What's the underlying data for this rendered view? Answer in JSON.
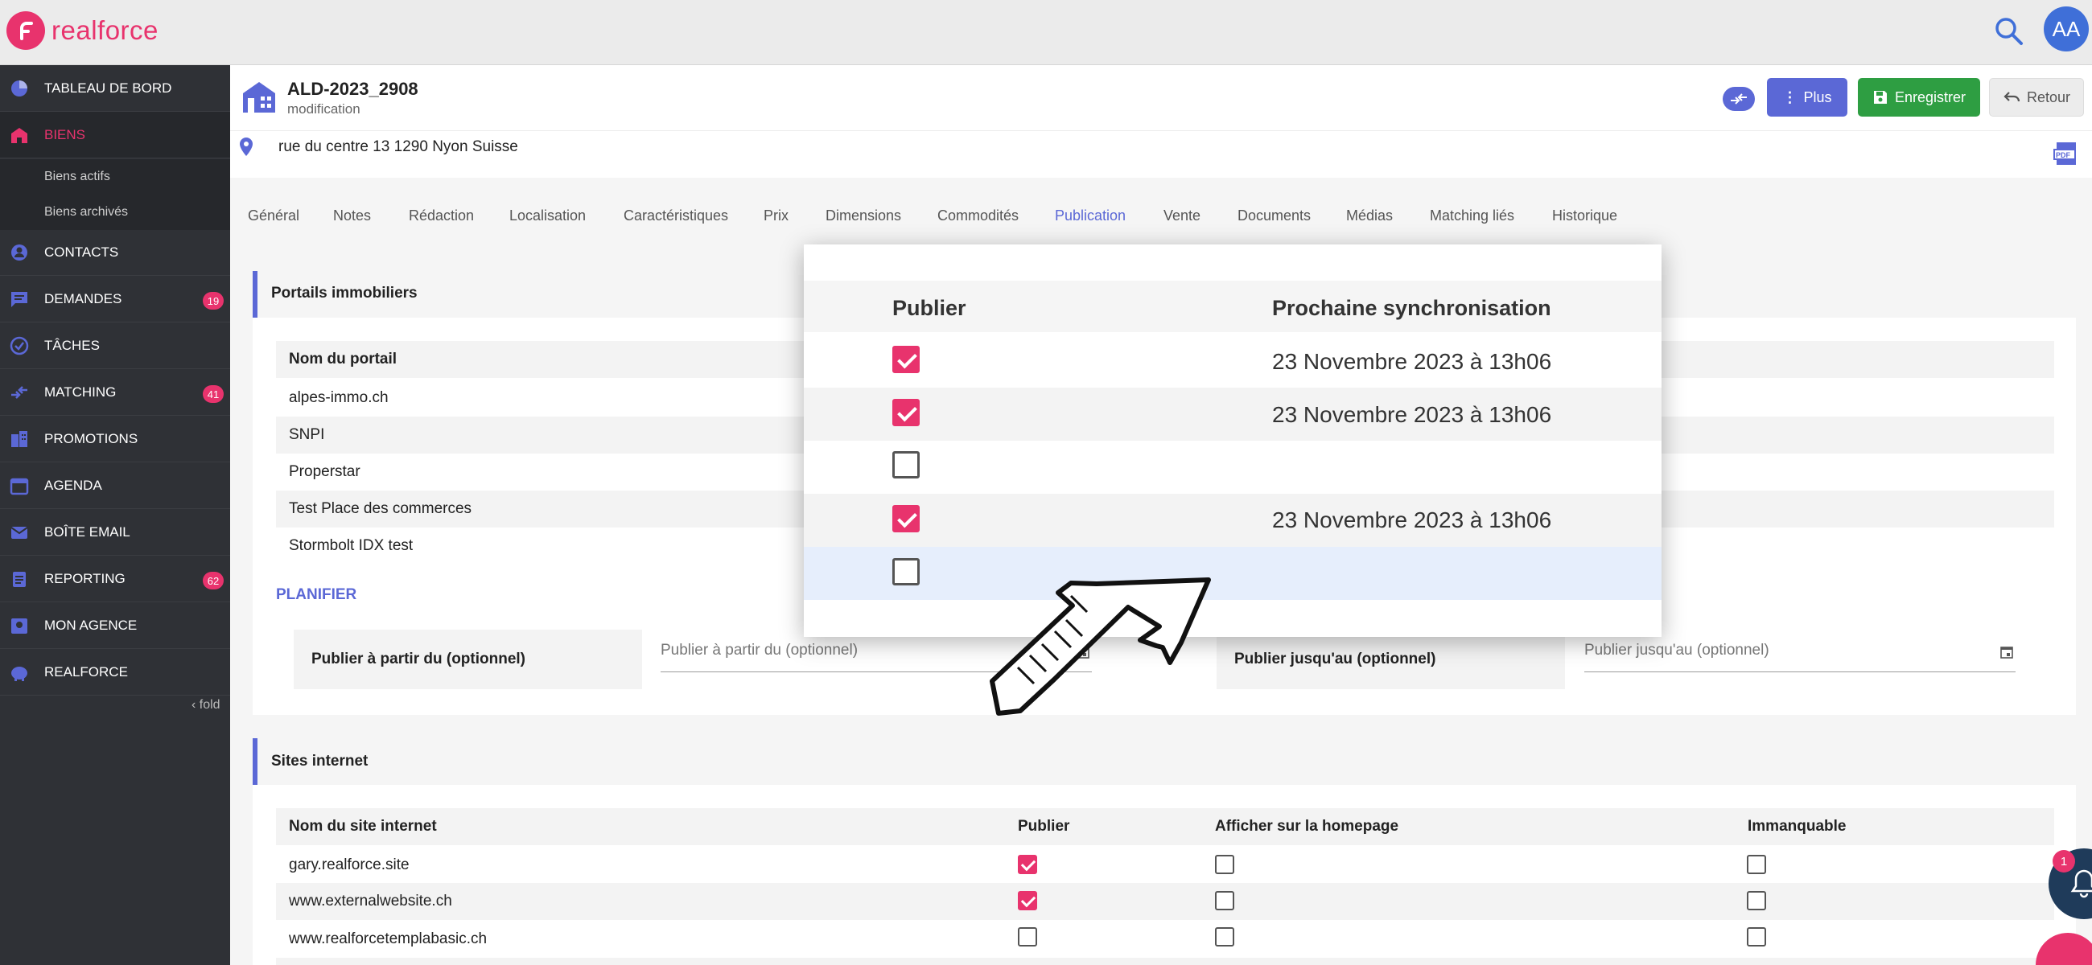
{
  "app": {
    "brand": "realforce",
    "avatar_initials": "AA",
    "accent": "#e8336d",
    "primary": "#5b68d6",
    "success": "#2e9e42"
  },
  "sidebar": {
    "items": [
      {
        "label": "TABLEAU DE BORD",
        "icon": "dashboard-icon"
      },
      {
        "label": "BIENS",
        "icon": "home-icon",
        "active": true
      },
      {
        "label": "CONTACTS",
        "icon": "contact-icon"
      },
      {
        "label": "DEMANDES",
        "icon": "message-icon",
        "badge": "19"
      },
      {
        "label": "TÂCHES",
        "icon": "check-circle-icon"
      },
      {
        "label": "MATCHING",
        "icon": "swap-icon",
        "badge": "41"
      },
      {
        "label": "PROMOTIONS",
        "icon": "building-icon"
      },
      {
        "label": "AGENDA",
        "icon": "calendar-icon"
      },
      {
        "label": "BOÎTE EMAIL",
        "icon": "mail-icon"
      },
      {
        "label": "REPORTING",
        "icon": "clipboard-icon",
        "badge": "62"
      },
      {
        "label": "MON AGENCE",
        "icon": "agency-icon"
      },
      {
        "label": "REALFORCE",
        "icon": "piggy-icon"
      }
    ],
    "sub_items": [
      "Biens actifs",
      "Biens archivés"
    ],
    "fold_label": "fold"
  },
  "header": {
    "title": "ALD-2023_2908",
    "subtitle": "modification",
    "address": "rue du centre 13 1290 Nyon Suisse",
    "plus_label": "Plus",
    "save_label": "Enregistrer",
    "back_label": "Retour"
  },
  "tabs": [
    "Général",
    "Notes",
    "Rédaction",
    "Localisation",
    "Caractéristiques",
    "Prix",
    "Dimensions",
    "Commodités",
    "Publication",
    "Vente",
    "Documents",
    "Médias",
    "Matching liés",
    "Historique"
  ],
  "active_tab": "Publication",
  "portails": {
    "title": "Portails immobiliers",
    "col_name": "Nom du portail",
    "rows": [
      "alpes-immo.ch",
      "SNPI",
      "Properstar",
      "Test Place des commerces",
      "Stormbolt IDX test"
    ],
    "planifier": "PLANIFIER",
    "from_label": "Publier à partir du (optionnel)",
    "from_placeholder": "Publier à partir du (optionnel)",
    "to_label": "Publier jusqu'au (optionnel)",
    "to_placeholder": "Publier jusqu'au (optionnel)"
  },
  "popup": {
    "col_publish": "Publier",
    "col_sync": "Prochaine synchronisation",
    "rows": [
      {
        "checked": true,
        "sync": "23 Novembre 2023 à 13h06"
      },
      {
        "checked": true,
        "sync": "23 Novembre 2023 à 13h06"
      },
      {
        "checked": false,
        "sync": ""
      },
      {
        "checked": true,
        "sync": "23 Novembre 2023 à 13h06"
      },
      {
        "checked": false,
        "sync": ""
      }
    ]
  },
  "sites": {
    "title": "Sites internet",
    "col_name": "Nom du site internet",
    "col_publish": "Publier",
    "col_homepage": "Afficher sur la homepage",
    "col_must": "Immanquable",
    "rows": [
      {
        "name": "gary.realforce.site",
        "publish": true,
        "homepage": false,
        "must": false
      },
      {
        "name": "www.externalwebsite.ch",
        "publish": true,
        "homepage": false,
        "must": false
      },
      {
        "name": "www.realforcetemplabasic.ch",
        "publish": false,
        "homepage": false,
        "must": false
      }
    ]
  },
  "notifications": {
    "count": "1"
  }
}
